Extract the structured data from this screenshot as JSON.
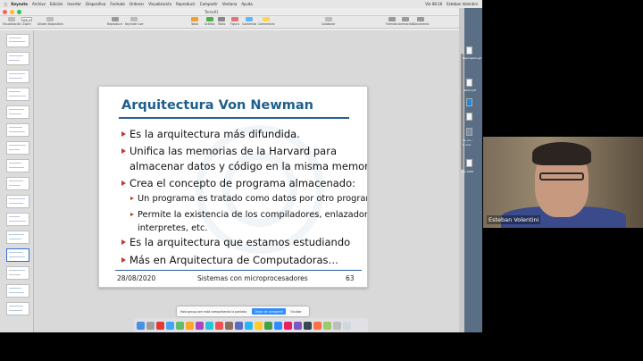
{
  "menubar": {
    "app": "Keynote",
    "items": [
      "Archivo",
      "Edición",
      "Insertar",
      "Diapositiva",
      "Formato",
      "Ordenar",
      "Visualización",
      "Reproducir",
      "Compartir",
      "Ventana",
      "Ayuda"
    ],
    "clock": "Vie 08:16",
    "user": "Esteban Volentini"
  },
  "window": {
    "title": "Tema01",
    "toolbar": {
      "visualizacion": "Visualización",
      "zoom": "Zoom",
      "zoom_value": "100 %",
      "anadir": "Añadir diapositiva",
      "reproducir": "Reproducir",
      "keynote_live": "Keynote Live",
      "tabla": "Tabla",
      "grafica": "Gráfica",
      "texto": "Texto",
      "figura": "Figura",
      "contenido": "Contenido",
      "comentario": "Comentario",
      "colaborar": "Colaborar",
      "formato": "Formato",
      "animacion": "Animación",
      "documento": "Documento"
    }
  },
  "slide": {
    "title": "Arquitectura Von Newman",
    "bullets": [
      "Es la arquitectura más difundida.",
      "Unifica las memorias de la Harvard para",
      "almacenar datos y código en la misma memoria.",
      "Crea el concepto de programa almacenado:",
      "Es la arquitectura que estamos estudiando",
      "Más en Arquitectura de Computadoras…"
    ],
    "subbullets": [
      "Un programa es tratado como datos por otro programa",
      "Permite la existencia de los compiladores, enlazadores,",
      "interpretes, etc."
    ],
    "footer": {
      "date": "28/08/2020",
      "center": "Sistemas con microprocesadores",
      "page": "63"
    }
  },
  "notice": {
    "text": "Host group.com está compartiendo la pantalla",
    "stop": "Dejar de compartir",
    "hide": "Ocultar"
  },
  "participant": {
    "name": "Esteban Volentini"
  },
  "desktop": {
    "files": [
      "Reemplazo.gif",
      "_2004.pdf",
      "de vio...",
      "2.mov",
      "de 2020"
    ]
  },
  "colors": {
    "title_blue": "#1f5f8b",
    "bullet_red": "#c0392b",
    "rule_blue": "#2b5f94",
    "zoom_blue": "#2d8cff"
  }
}
